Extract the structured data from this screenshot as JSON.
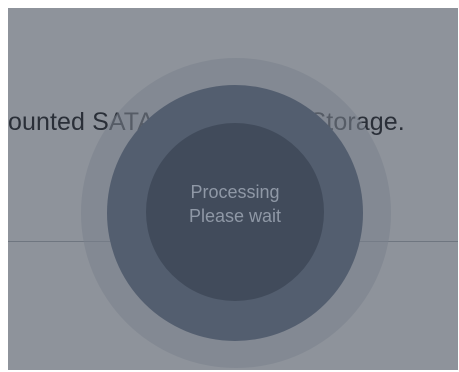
{
  "background": {
    "message": "ounted SATA HDD or USB Storage."
  },
  "overlay": {
    "line1": "Processing",
    "line2": "Please wait"
  },
  "colors": {
    "dim": "#8e939b",
    "ring_outer": "#7a818c",
    "ring_mid": "#535e6f",
    "ring_inner": "#414b5b",
    "label": "#8f98a6"
  }
}
